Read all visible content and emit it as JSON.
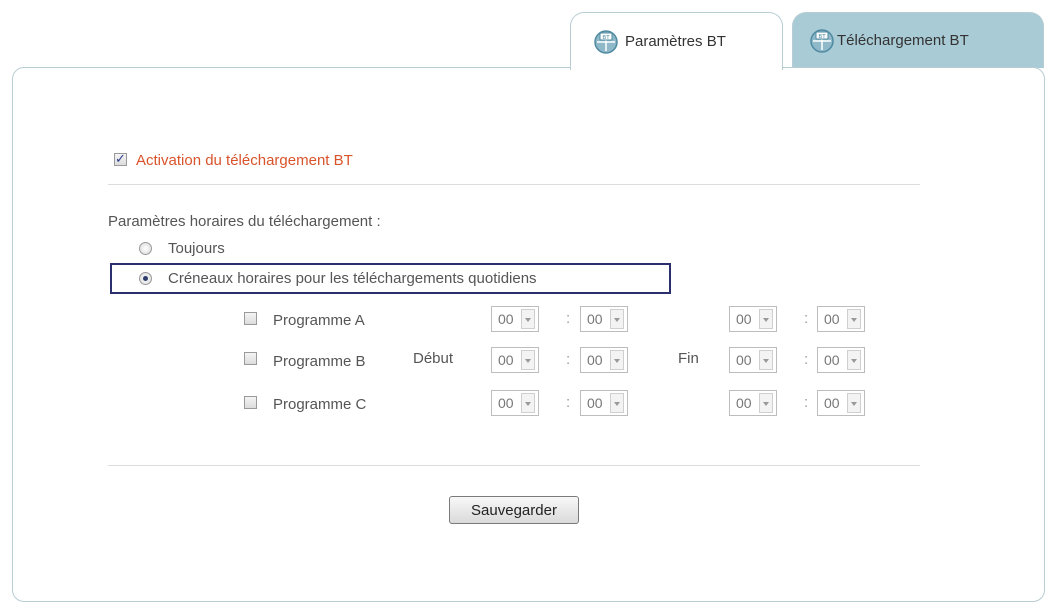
{
  "tabs": [
    {
      "label": "Paramètres BT",
      "active": true,
      "icon": "bt-globe-icon"
    },
    {
      "label": "Téléchargement BT",
      "active": false,
      "icon": "bt-globe-icon"
    }
  ],
  "activation": {
    "label": "Activation du téléchargement BT",
    "checked": true
  },
  "schedule": {
    "heading": "Paramètres horaires du téléchargement :",
    "options": [
      {
        "label": "Toujours",
        "selected": false
      },
      {
        "label": "Créneaux horaires pour les téléchargements quotidiens",
        "selected": true
      }
    ],
    "start_label": "Début",
    "end_label": "Fin",
    "programs": [
      {
        "label": "Programme A",
        "checked": false,
        "start_h": "00",
        "start_m": "00",
        "end_h": "00",
        "end_m": "00"
      },
      {
        "label": "Programme B",
        "checked": false,
        "start_h": "00",
        "start_m": "00",
        "end_h": "00",
        "end_m": "00"
      },
      {
        "label": "Programme C",
        "checked": false,
        "start_h": "00",
        "start_m": "00",
        "end_h": "00",
        "end_m": "00"
      }
    ]
  },
  "save_label": "Sauvegarder",
  "colors": {
    "active_tab_bg": "#ffffff",
    "inactive_tab_bg": "#a9cbd6",
    "activation_text": "#d9532b",
    "highlight_border": "#2c2f6e"
  }
}
